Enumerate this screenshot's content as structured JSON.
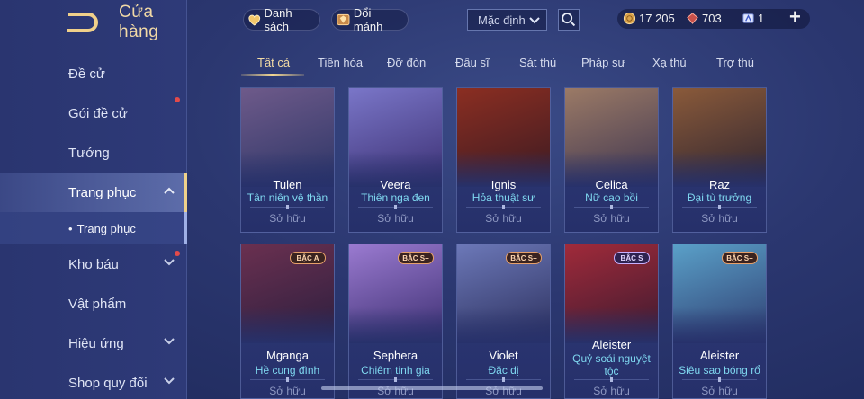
{
  "header": {
    "title": "Cửa hàng"
  },
  "sidebar": {
    "items": [
      {
        "label": "Đề cử",
        "chevron": false,
        "dot": false
      },
      {
        "label": "Gói đề cử",
        "chevron": false,
        "dot": true
      },
      {
        "label": "Tướng",
        "chevron": false,
        "dot": false
      },
      {
        "label": "Trang phục",
        "chevron": "up",
        "dot": false,
        "active": true
      },
      {
        "label": "Kho báu",
        "chevron": "down",
        "dot": true
      },
      {
        "label": "Vật phẩm",
        "chevron": false,
        "dot": false
      },
      {
        "label": "Hiệu ứng",
        "chevron": "down",
        "dot": false
      },
      {
        "label": "Shop quy đổi",
        "chevron": "down",
        "dot": false
      }
    ],
    "sub_item": "Trang phục"
  },
  "topbar": {
    "list_label": "Danh sách",
    "exchange_label": "Đổi mảnh",
    "sort_value": "Mặc định",
    "gold": "17 205",
    "gems": "703",
    "vouchers": "1"
  },
  "tabs": [
    "Tất cả",
    "Tiến hóa",
    "Đỡ đòn",
    "Đấu sĩ",
    "Sát thủ",
    "Pháp sư",
    "Xạ thủ",
    "Trợ thủ"
  ],
  "cards": [
    {
      "hero": "Tulen",
      "skin": "Tân niên vệ thần",
      "status": "Sở hữu",
      "badge": "",
      "colors": [
        "#6e5a8a",
        "#2c3566"
      ]
    },
    {
      "hero": "Veera",
      "skin": "Thiên nga đen",
      "status": "Sở hữu",
      "badge": "",
      "colors": [
        "#7a76c8",
        "#3b2f72"
      ]
    },
    {
      "hero": "Ignis",
      "skin": "Hỏa thuật sư",
      "status": "Sở hữu",
      "badge": "",
      "colors": [
        "#8b2e22",
        "#3a1a22"
      ]
    },
    {
      "hero": "Celica",
      "skin": "Nữ cao bồi",
      "status": "Sở hữu",
      "badge": "",
      "colors": [
        "#9b7a66",
        "#3e3550"
      ]
    },
    {
      "hero": "Raz",
      "skin": "Đại tù trưởng",
      "status": "Sở hữu",
      "badge": "",
      "colors": [
        "#8a5a3a",
        "#2e2430"
      ]
    },
    {
      "hero": "Mganga",
      "skin": "Hề cung đình",
      "status": "Sở hữu",
      "badge": "BẬC A",
      "badge_style": "a",
      "colors": [
        "#6a3050",
        "#2a1e3e"
      ]
    },
    {
      "hero": "Sephera",
      "skin": "Chiêm tinh gia",
      "status": "Sở hữu",
      "badge": "BẬC S+",
      "badge_style": "a",
      "colors": [
        "#9a7ad0",
        "#3b2e70"
      ]
    },
    {
      "hero": "Violet",
      "skin": "Đặc dị",
      "status": "Sở hữu",
      "badge": "BẬC S+",
      "badge_style": "a",
      "colors": [
        "#6c78b8",
        "#2b2f5c"
      ]
    },
    {
      "hero": "Aleister",
      "skin": "Quỷ soái nguyệt tộc",
      "status": "Sở hữu",
      "badge": "BẬC S",
      "badge_style": "s",
      "colors": [
        "#a02a3a",
        "#3a1a30"
      ]
    },
    {
      "hero": "Aleister",
      "skin": "Siêu sao bóng rổ",
      "status": "Sở hữu",
      "badge": "BẬC S+",
      "badge_style": "a",
      "colors": [
        "#5aa0c8",
        "#2e3c70"
      ]
    }
  ]
}
